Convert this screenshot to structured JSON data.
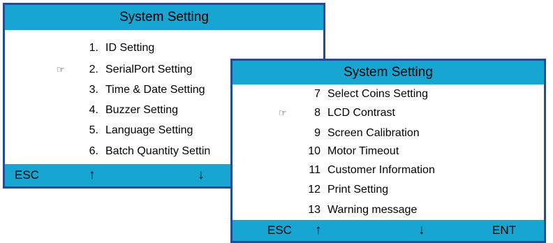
{
  "screens": [
    {
      "title": "System Setting",
      "items": [
        {
          "num": "1.",
          "label": "ID Setting"
        },
        {
          "num": "2.",
          "label": "SerialPort Setting"
        },
        {
          "num": "3.",
          "label": "Time & Date Setting"
        },
        {
          "num": "4.",
          "label": "Buzzer Setting"
        },
        {
          "num": "5.",
          "label": "Language Setting"
        },
        {
          "num": "6.",
          "label": "Batch Quantity Settin"
        }
      ],
      "pointer_icon": "pointing-hand-icon",
      "pointer_glyph": "☞",
      "softkeys": {
        "esc": "ESC",
        "up": "↑",
        "down": "↓"
      }
    },
    {
      "title": "System Setting",
      "items": [
        {
          "num": "7",
          "label": "Select Coins Setting"
        },
        {
          "num": "8",
          "label": "LCD Contrast"
        },
        {
          "num": "9",
          "label": "Screen Calibration"
        },
        {
          "num": "10",
          "label": "Motor Timeout"
        },
        {
          "num": "11",
          "label": "Customer Information"
        },
        {
          "num": "12",
          "label": "Print Setting"
        },
        {
          "num": "13",
          "label": "Warning message"
        }
      ],
      "pointer_icon": "pointing-hand-icon",
      "pointer_glyph": "☞",
      "softkeys": {
        "esc": "ESC",
        "up": "↑",
        "down": "↓",
        "ent": "ENT"
      }
    }
  ],
  "colors": {
    "bar": "#17a5d1",
    "border": "#1f4e96",
    "background": "#ffffff",
    "text": "#000000"
  }
}
